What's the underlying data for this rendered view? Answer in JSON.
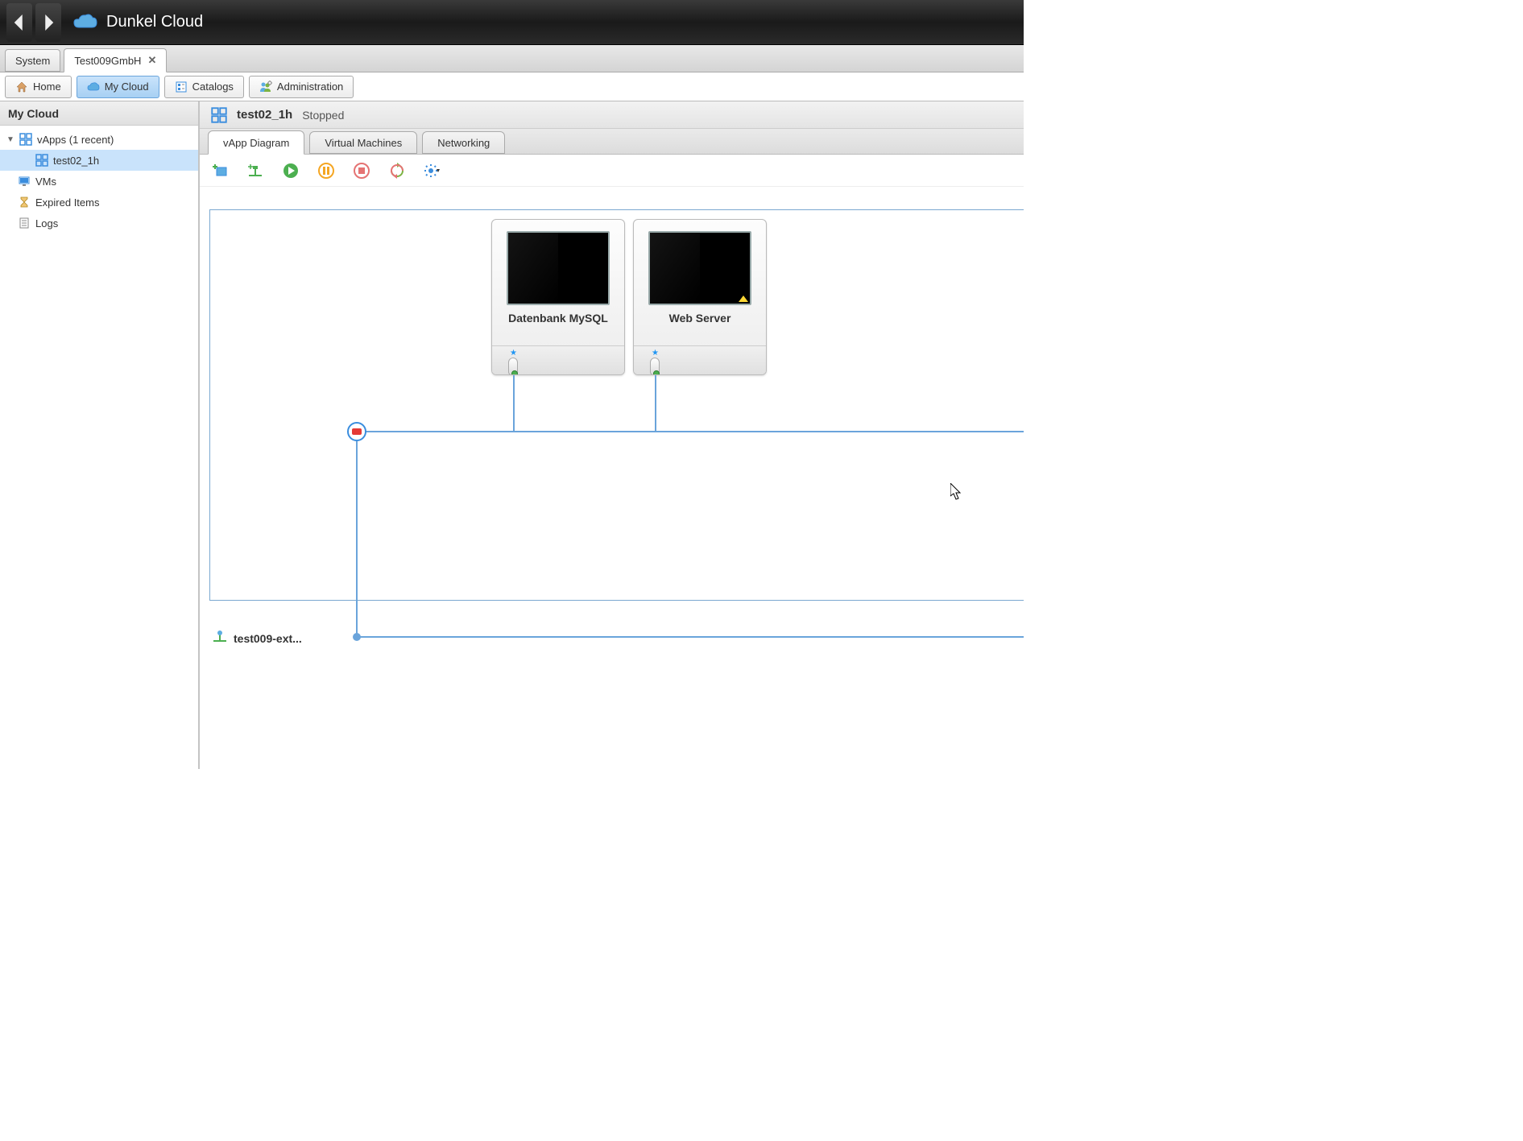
{
  "header": {
    "title": "Dunkel Cloud"
  },
  "orgTabs": [
    {
      "label": "System",
      "closable": false,
      "active": false
    },
    {
      "label": "Test009GmbH",
      "closable": true,
      "active": true
    }
  ],
  "mainNav": {
    "home": "Home",
    "mycloud": "My Cloud",
    "catalogs": "Catalogs",
    "administration": "Administration",
    "active": "mycloud"
  },
  "sidebar": {
    "title": "My Cloud",
    "items": {
      "vapps": {
        "label": "vApps (1 recent)",
        "expanded": true,
        "children": [
          {
            "label": "test02_1h",
            "selected": true
          }
        ]
      },
      "vms": {
        "label": "VMs"
      },
      "expired": {
        "label": "Expired Items"
      },
      "logs": {
        "label": "Logs"
      }
    }
  },
  "content": {
    "title": "test02_1h",
    "status": "Stopped",
    "tabs": {
      "diagram": "vApp Diagram",
      "vms": "Virtual Machines",
      "networking": "Networking",
      "active": "diagram"
    },
    "vms": [
      {
        "name": "Datenbank MySQL"
      },
      {
        "name": "Web Server"
      }
    ],
    "externalNetwork": "test009-ext..."
  }
}
